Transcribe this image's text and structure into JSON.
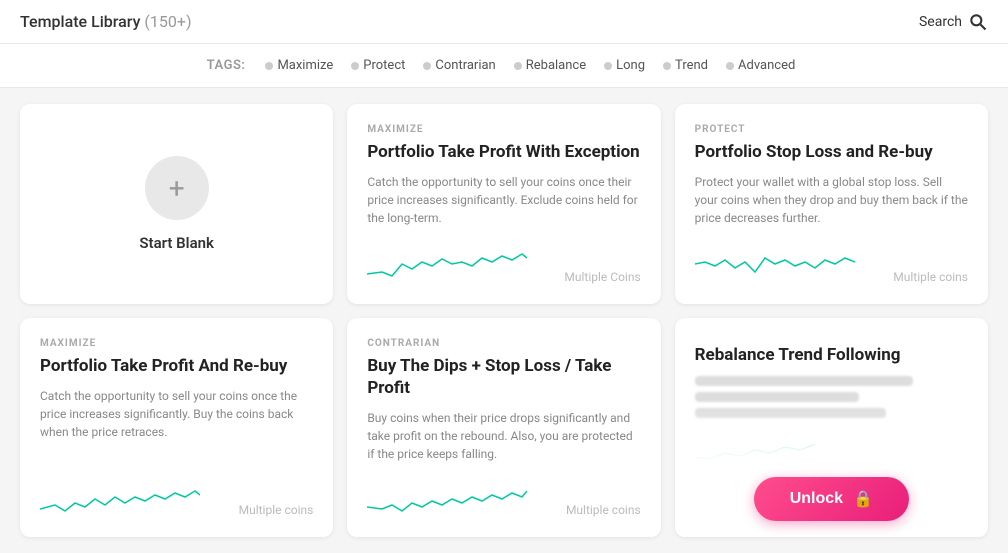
{
  "header": {
    "title": "Template Library",
    "count": "(150+)",
    "search_label": "Search"
  },
  "tags": {
    "label": "TAGS:",
    "items": [
      {
        "name": "maximize",
        "label": "Maximize"
      },
      {
        "name": "protect",
        "label": "Protect"
      },
      {
        "name": "contrarian",
        "label": "Contrarian"
      },
      {
        "name": "rebalance",
        "label": "Rebalance"
      },
      {
        "name": "long",
        "label": "Long"
      },
      {
        "name": "trend",
        "label": "Trend"
      },
      {
        "name": "advanced",
        "label": "Advanced"
      }
    ]
  },
  "cards": {
    "blank": {
      "label": "Start Blank"
    },
    "card1": {
      "tag": "MAXIMIZE",
      "title": "Portfolio Take Profit With Exception",
      "desc": "Catch the opportunity to sell your coins once their price increases significantly. Exclude coins held for the long-term.",
      "coins": "Multiple Coins"
    },
    "card2": {
      "tag": "PROTECT",
      "title": "Portfolio Stop Loss and Re-buy",
      "desc": "Protect your wallet with a global stop loss. Sell your coins when they drop and buy them back if the price decreases further.",
      "coins": "Multiple coins"
    },
    "card3": {
      "tag": "MAXIMIZE",
      "title": "Portfolio Take Profit And Re-buy",
      "desc": "Catch the opportunity to sell your coins once the price increases significantly. Buy the coins back when the price retraces.",
      "coins": "Multiple coins"
    },
    "card4": {
      "tag": "CONTRARIAN",
      "title": "Buy The Dips + Stop Loss / Take Profit",
      "desc": "Buy coins when their price drops significantly and take profit on the rebound. Also, you are protected if the price keeps falling.",
      "coins": "Multiple coins"
    },
    "card5": {
      "tag": "",
      "title": "Rebalance Trend Following",
      "desc_blurred": true,
      "unlock_label": "Unlock"
    }
  }
}
